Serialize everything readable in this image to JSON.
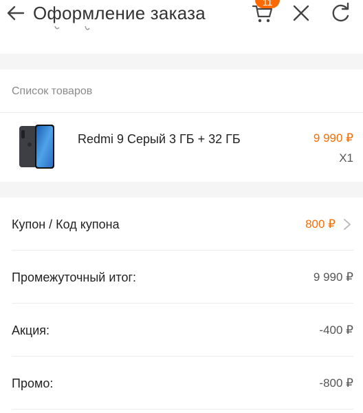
{
  "header": {
    "title": "Оформление заказа",
    "cart_badge": "11",
    "icons": [
      "back-arrow-icon",
      "cart-icon",
      "close-icon",
      "refresh-icon"
    ]
  },
  "products": {
    "section_label": "Список товаров",
    "items": [
      {
        "name": "Redmi 9 Серый 3 ГБ + 32 ГБ",
        "price": "9 990 ₽",
        "quantity": "X1"
      }
    ]
  },
  "summary": {
    "coupon": {
      "label": "Купон / Код купона",
      "value": "800 ₽"
    },
    "subtotal": {
      "label": "Промежуточный итог:",
      "value": "9 990 ₽"
    },
    "promotion": {
      "label": "Акция:",
      "value": "-400 ₽"
    },
    "promo": {
      "label": "Промо:",
      "value": "-800 ₽"
    }
  },
  "colors": {
    "accent": "#ff6a00",
    "background": "#f5f5f5",
    "card": "#ffffff"
  }
}
